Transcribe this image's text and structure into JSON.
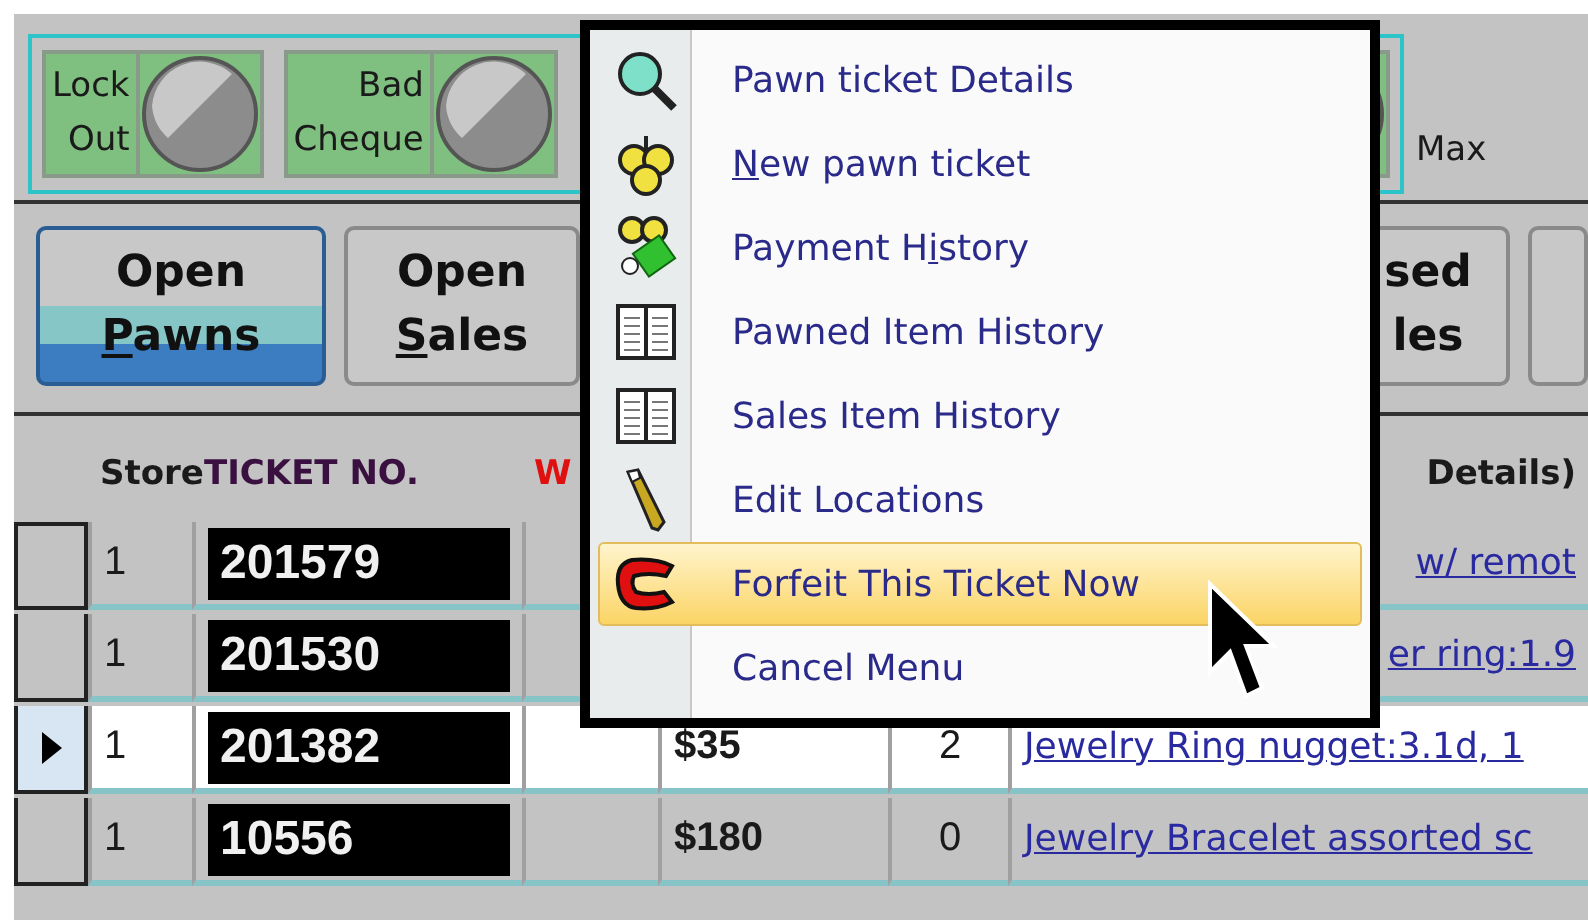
{
  "indicators": [
    {
      "label_lines": [
        "Lock",
        "Out"
      ],
      "on": false
    },
    {
      "label_lines": [
        "Bad",
        "Cheque"
      ],
      "on": false
    }
  ],
  "indicator_caption": "Max",
  "buttons": [
    {
      "line1": "Open",
      "mnemonic": "P",
      "rest": "awns",
      "selected": true
    },
    {
      "line1": "Open",
      "mnemonic": "S",
      "rest": "ales",
      "selected": false
    },
    {
      "line1": "sed",
      "rest": "les",
      "selected": false
    }
  ],
  "table": {
    "columns": [
      {
        "label": "Store",
        "color": "#1a1a1a"
      },
      {
        "label": "TICKET NO.",
        "color": "#3a1040"
      },
      {
        "label": "W",
        "color": "#e01010"
      },
      {
        "label": "Details)",
        "color": "#1a1a1a"
      }
    ],
    "rows": [
      {
        "selected": false,
        "store": "1",
        "ticket": "201579",
        "description": "w/ remot"
      },
      {
        "selected": false,
        "store": "1",
        "ticket": "201530",
        "description": "er ring:1.9"
      },
      {
        "selected": true,
        "store": "1",
        "ticket": "201382",
        "amount": "$35",
        "count": "2",
        "description": "Jewelry Ring nugget:3.1d, 1"
      },
      {
        "selected": false,
        "store": "1",
        "ticket": "10556",
        "amount": "$180",
        "count": "0",
        "description": "Jewelry Bracelet assorted sc"
      }
    ]
  },
  "context_menu": {
    "items": [
      {
        "kind": "magnifier",
        "before": "Pawn ticket Details",
        "selected": false
      },
      {
        "kind": "balls",
        "mnemonic": "N",
        "after": "ew pawn ticket",
        "selected": false
      },
      {
        "kind": "payment",
        "before": "Payment H",
        "mnemonic": "i",
        "after": "story",
        "selected": false
      },
      {
        "kind": "book",
        "before": "Pawned Item History",
        "selected": false
      },
      {
        "kind": "book",
        "before": "Sales Item History",
        "selected": false
      },
      {
        "kind": "pencil",
        "before": "Edit Locations",
        "selected": false
      },
      {
        "kind": "clamp",
        "before": "Forfeit This Ticket Now",
        "selected": true
      },
      {
        "kind": "none",
        "before": "Cancel Menu",
        "selected": false
      }
    ]
  }
}
